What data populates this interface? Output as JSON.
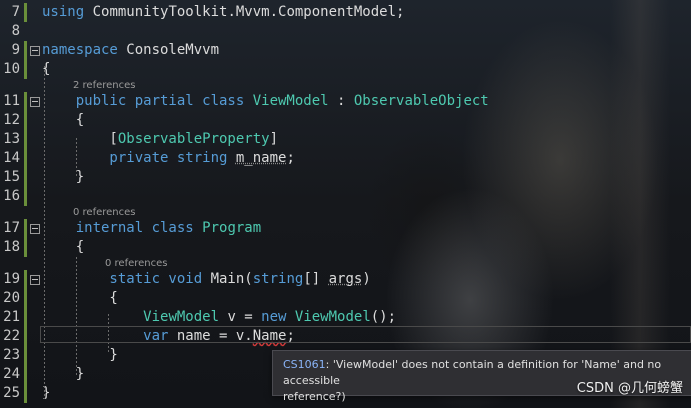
{
  "editor": {
    "lines": [
      {
        "num": "7",
        "parts": [
          {
            "t": "using",
            "c": "kw"
          },
          {
            "t": " CommunityToolkit.Mvvm.ComponentModel;",
            "c": "ident"
          }
        ]
      },
      {
        "num": "8",
        "parts": []
      },
      {
        "num": "9",
        "parts": [
          {
            "t": "namespace",
            "c": "kw"
          },
          {
            "t": " ConsoleMvvm",
            "c": "ident"
          }
        ]
      },
      {
        "num": "10",
        "parts": [
          {
            "t": "{",
            "c": "ident"
          }
        ]
      },
      {
        "num": "11",
        "parts": [
          {
            "t": "    public partial class ",
            "c": "kw"
          },
          {
            "t": "ViewModel",
            "c": "ty"
          },
          {
            "t": " : ",
            "c": "ident"
          },
          {
            "t": "ObservableObject",
            "c": "ty"
          }
        ]
      },
      {
        "num": "12",
        "parts": [
          {
            "t": "    {",
            "c": "ident"
          }
        ]
      },
      {
        "num": "13",
        "parts": [
          {
            "t": "        [",
            "c": "ident"
          },
          {
            "t": "ObservableProperty",
            "c": "ty"
          },
          {
            "t": "]",
            "c": "ident"
          }
        ]
      },
      {
        "num": "14",
        "parts": [
          {
            "t": "        private string ",
            "c": "kw"
          },
          {
            "t": "m_name",
            "c": "ident dots"
          },
          {
            "t": ";",
            "c": "ident"
          }
        ]
      },
      {
        "num": "15",
        "parts": [
          {
            "t": "    }",
            "c": "ident"
          }
        ]
      },
      {
        "num": "16",
        "parts": []
      },
      {
        "num": "17",
        "parts": [
          {
            "t": "    internal class ",
            "c": "kw"
          },
          {
            "t": "Program",
            "c": "ty"
          }
        ]
      },
      {
        "num": "18",
        "parts": [
          {
            "t": "    {",
            "c": "ident"
          }
        ]
      },
      {
        "num": "19",
        "parts": [
          {
            "t": "        static void ",
            "c": "kw"
          },
          {
            "t": "Main(",
            "c": "ident"
          },
          {
            "t": "string",
            "c": "kw"
          },
          {
            "t": "[] ",
            "c": "ident"
          },
          {
            "t": "args",
            "c": "ident dots"
          },
          {
            "t": ")",
            "c": "ident"
          }
        ]
      },
      {
        "num": "20",
        "parts": [
          {
            "t": "        {",
            "c": "ident"
          }
        ]
      },
      {
        "num": "21",
        "parts": [
          {
            "t": "            ",
            "c": "ident"
          },
          {
            "t": "ViewModel",
            "c": "ty"
          },
          {
            "t": " v = ",
            "c": "ident"
          },
          {
            "t": "new ",
            "c": "kw"
          },
          {
            "t": "ViewModel",
            "c": "ty"
          },
          {
            "t": "();",
            "c": "ident"
          }
        ]
      },
      {
        "num": "22",
        "parts": [
          {
            "t": "            ",
            "c": "ident"
          },
          {
            "t": "var",
            "c": "kw"
          },
          {
            "t": " name = v.",
            "c": "ident"
          },
          {
            "t": "Name",
            "c": "ident squiggle"
          },
          {
            "t": ";",
            "c": "ident"
          }
        ]
      },
      {
        "num": "23",
        "parts": [
          {
            "t": "        }",
            "c": "ident"
          }
        ]
      },
      {
        "num": "24",
        "parts": [
          {
            "t": "    }",
            "c": "ident"
          }
        ]
      },
      {
        "num": "25",
        "parts": [
          {
            "t": "}",
            "c": "ident"
          }
        ]
      }
    ],
    "codelens": [
      {
        "after_line": "10",
        "text": "2 references",
        "indent": 1
      },
      {
        "after_line": "16",
        "text": "0 references",
        "indent": 1
      },
      {
        "after_line": "18",
        "text": "0 references",
        "indent": 2
      }
    ]
  },
  "tooltip": {
    "code": "CS1061",
    "message": ": 'ViewModel' does not contain a definition for 'Name' and no accessible",
    "message2": "reference?)"
  },
  "watermark": "CSDN @几何螃蟹"
}
